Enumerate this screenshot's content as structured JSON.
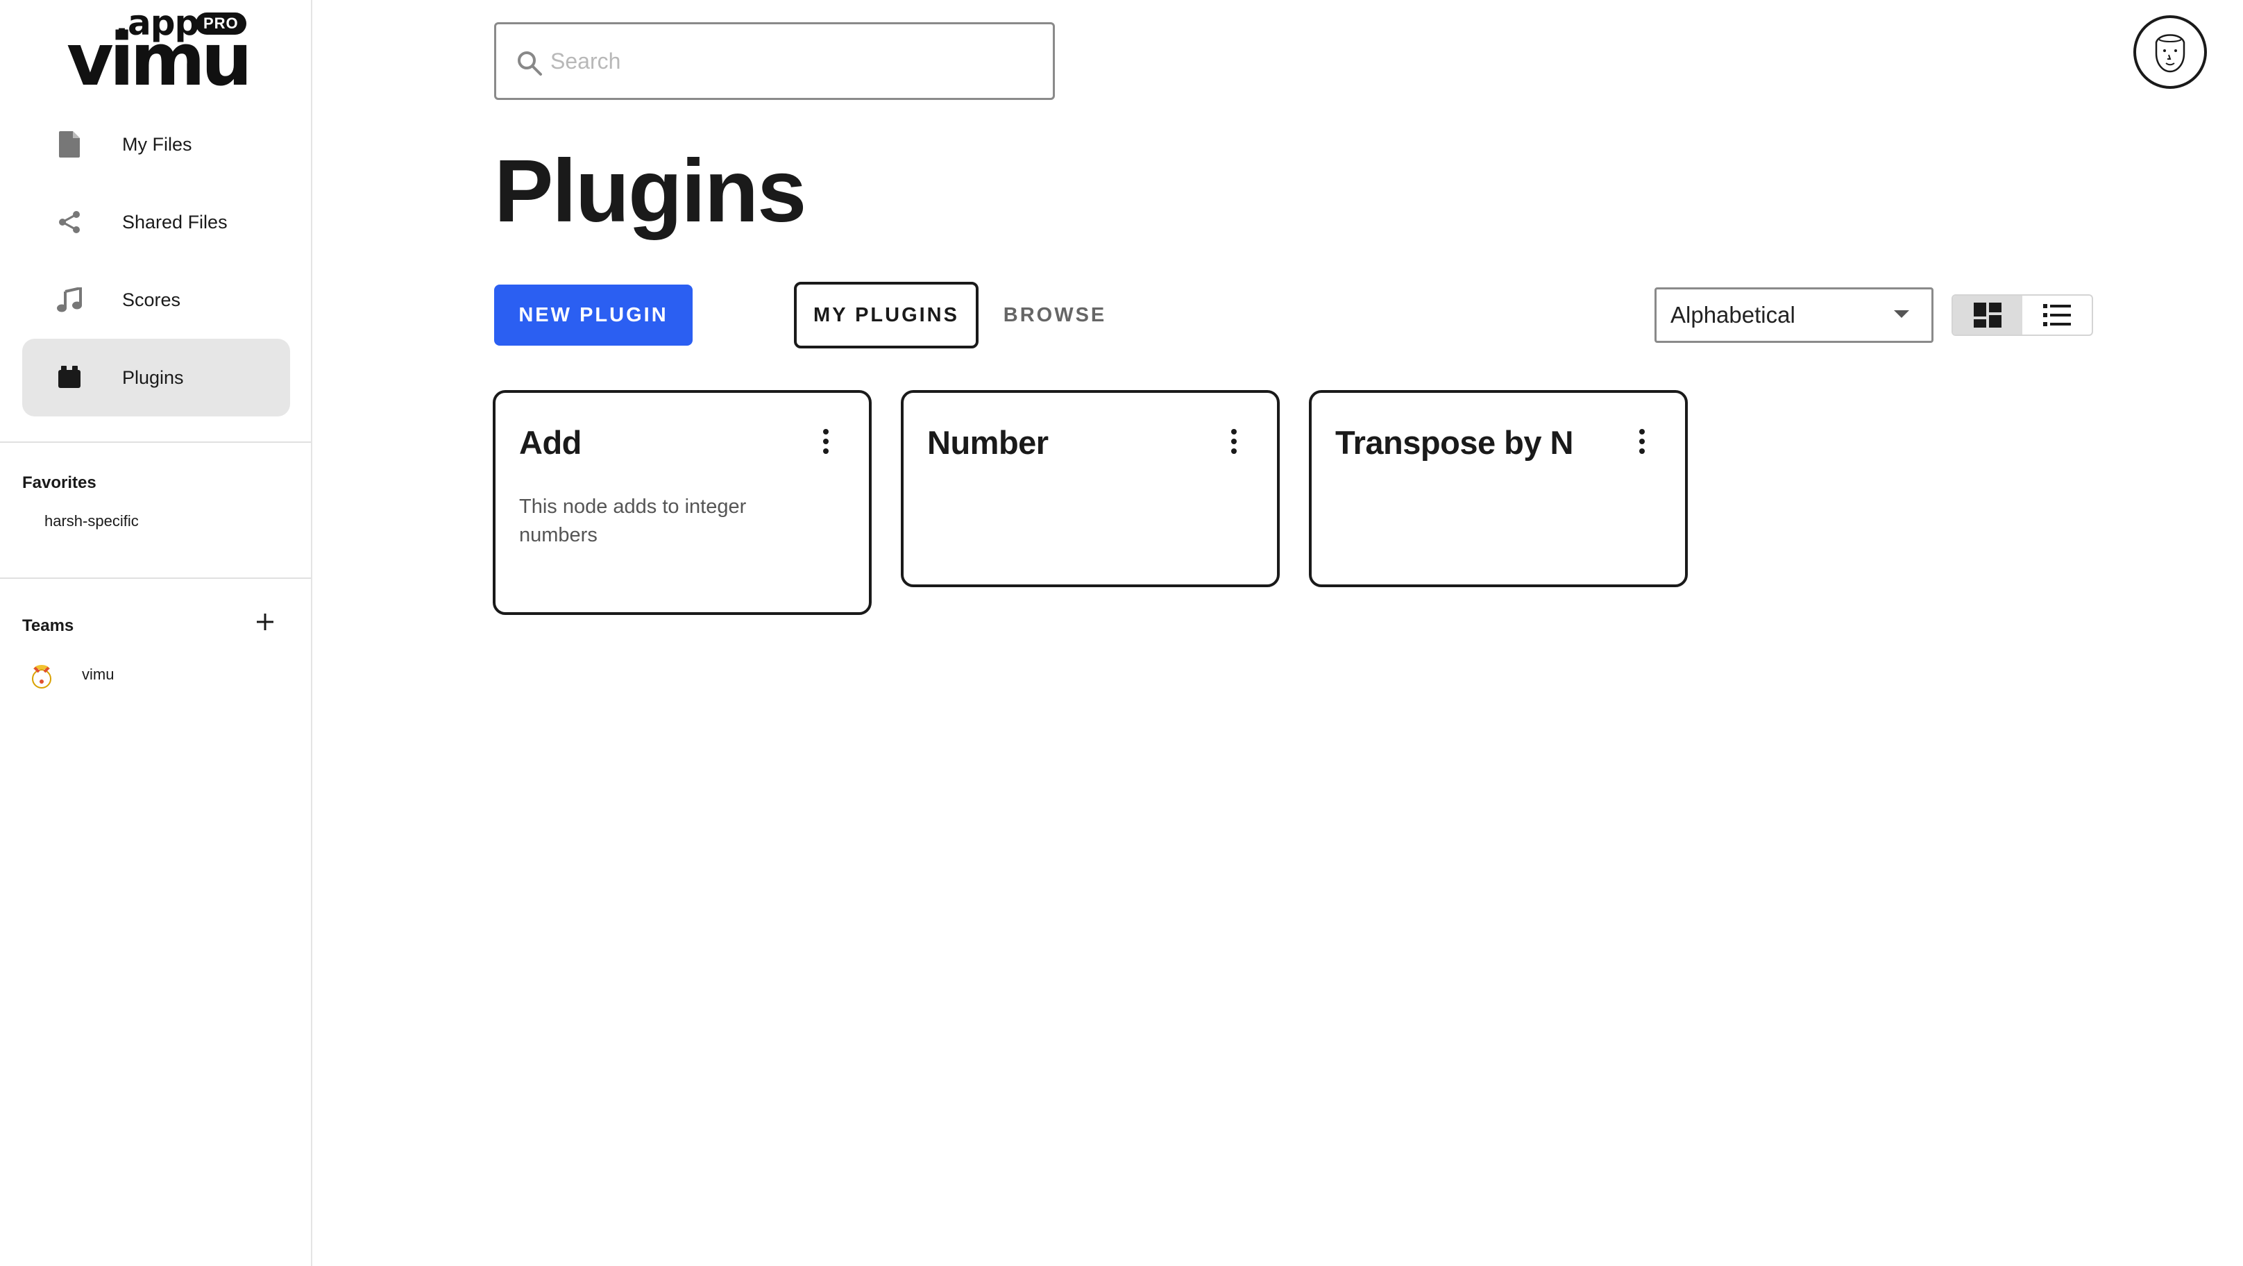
{
  "brand": {
    "app_suffix": ".app",
    "badge": "PRO",
    "name": "vimu"
  },
  "sidebar": {
    "items": [
      {
        "label": "My Files",
        "icon": "file-icon"
      },
      {
        "label": "Shared Files",
        "icon": "share-icon"
      },
      {
        "label": "Scores",
        "icon": "music-note-icon"
      },
      {
        "label": "Plugins",
        "icon": "plugin-icon",
        "active": true
      }
    ],
    "favorites_title": "Favorites",
    "favorites": [
      {
        "label": "harsh-specific"
      }
    ],
    "teams_title": "Teams",
    "teams": [
      {
        "label": "vimu",
        "icon": "team-avatar-icon"
      }
    ]
  },
  "search": {
    "placeholder": "Search",
    "value": ""
  },
  "page": {
    "title": "Plugins"
  },
  "toolbar": {
    "new_button": "NEW PLUGIN",
    "tabs": [
      {
        "label": "MY PLUGINS",
        "active": true
      },
      {
        "label": "BROWSE",
        "active": false
      }
    ],
    "sort": {
      "selected": "Alphabetical"
    },
    "view_mode": "grid"
  },
  "plugins": [
    {
      "title": "Add",
      "description": "This node adds to integer numbers"
    },
    {
      "title": "Number",
      "description": ""
    },
    {
      "title": "Transpose by N",
      "description": ""
    }
  ],
  "colors": {
    "accent": "#2b5ff2",
    "active_nav_bg": "#e6e6e6",
    "text": "#1a1a1a"
  }
}
